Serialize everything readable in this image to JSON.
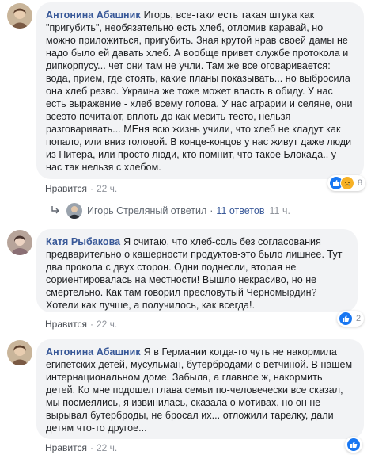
{
  "comments": [
    {
      "author": "Антонина Абашник",
      "text": "Игорь, все-таки есть такая штука как \"пригубить\", необязательно есть хлеб, отломив каравай, но можно приложиться, пригубить. Зная крутой нрав своей дамы не надо было ей давать хлеб. А вообще привет службе протокола и дипкорпусу... чет они там не учли. Там же все оговаривается: вода, прием, где стоять, какие планы показывать... но выбросила она хлеб резво. Украина же тоже может впасть в обиду. У нас есть выражение - хлеб всему голова. У нас аграрии и селяне, они всеэто почитают, вплоть до как месить тесто, нельзя разговаривать... МЕня всю жизнь учили, что хлеб не кладут как попало, или вниз головой. В конце-концов у нас живут даже люди из Питера, или просто люди, кто помнит, что такое Блокада.. у нас так нельзя с хлебом.",
      "like_label": "Нравится",
      "time": "22 ч.",
      "reaction_count": "8",
      "reactions": [
        "like-icon",
        "sad-icon"
      ]
    },
    {
      "author": "Катя Рыбакова",
      "text": "Я считаю, что хлеб-соль без согласования предварительно о кашерности продуктов-это было лишнее. Тут два прокола с двух сторон. Одни поднесли, вторая не сориентировалась на местности! Вышло некрасиво, но не смертельно. Как там говорил пресловутый Черномырдин? Хотели как лучше, а получилось, как всегда!.",
      "like_label": "Нравится",
      "time": "22 ч.",
      "reaction_count": "2",
      "reactions": [
        "like-icon"
      ]
    },
    {
      "author": "Антонина Абашник",
      "text": "Я в Германии когда-то чуть не накормила египетских детей, мусульман, бутербродами с ветчиной. В нашем интернациональном доме. Забыла, а главное ж, накормить детей. Ко мне подошел глава семьи по-человечески все сказал, мы посмеялись, я извинилась, сказала о мотивах, но он не вырывал бутерброды, не бросал их... отложили тарелку, дали детям что-то другое...",
      "like_label": "Нравится",
      "time": "22 ч.",
      "reaction_count": "",
      "reactions": [
        "like-icon"
      ]
    }
  ],
  "replies": {
    "name": "Игорь Стреляный ответил",
    "count": "11 ответов",
    "time": "11 ч."
  },
  "dot": "·",
  "colors": {
    "author": "#385898",
    "bubble": "#f2f3f5",
    "like_reaction": "#1877f2",
    "sad_reaction": "#f7b125"
  }
}
